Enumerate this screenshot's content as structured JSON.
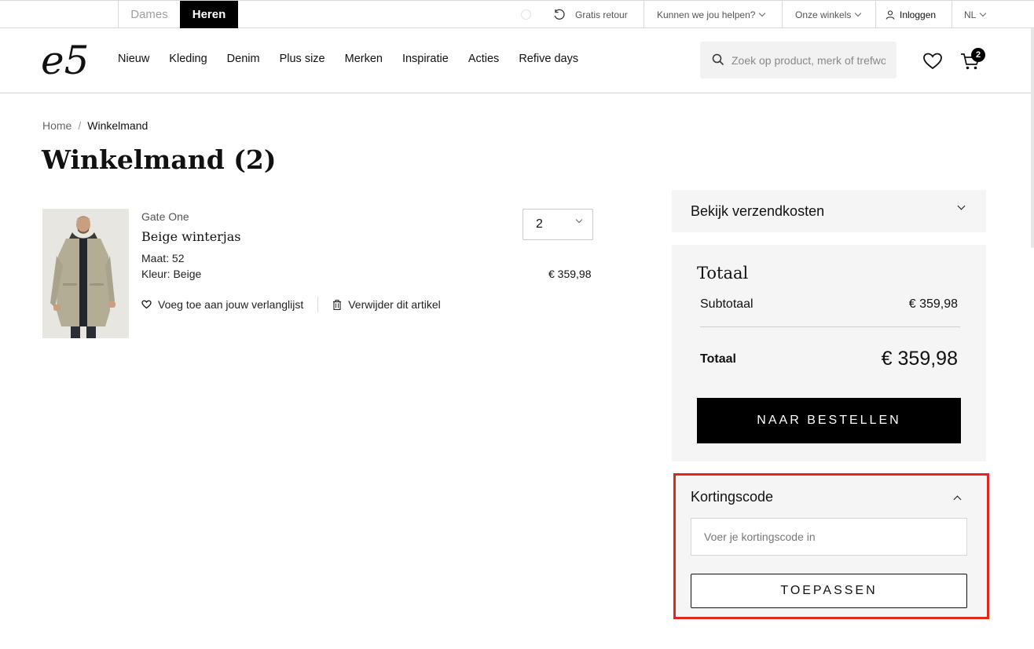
{
  "topbar": {
    "genders": [
      "Dames",
      "Heren"
    ],
    "active_gender": "Heren",
    "retour_label": "Gratis retour",
    "help_label": "Kunnen we jou helpen?",
    "stores_label": "Onze winkels",
    "login_label": "Inloggen",
    "language": "NL"
  },
  "header": {
    "logo_text": "e5",
    "nav": [
      "Nieuw",
      "Kleding",
      "Denim",
      "Plus size",
      "Merken",
      "Inspiratie",
      "Acties",
      "Refive days"
    ],
    "search_placeholder": "Zoek op product, merk of trefwoord",
    "cart_count": "2"
  },
  "breadcrumb": {
    "home": "Home",
    "separator": "/",
    "current": "Winkelmand"
  },
  "page_title": "Winkelmand (2)",
  "cart_item": {
    "brand": "Gate One",
    "name": "Beige winterjas",
    "size_label": "Maat:",
    "size": "52",
    "color_label": "Kleur:",
    "color": "Beige",
    "quantity": "2",
    "price": "€ 359,98",
    "wishlist_label": "Voeg toe aan jouw verlanglijst",
    "remove_label": "Verwijder dit artikel"
  },
  "summary": {
    "shipping_label": "Bekijk verzendkosten",
    "totals_title": "Totaal",
    "subtotal_label": "Subtotaal",
    "subtotal_value": "€ 359,98",
    "total_label": "Totaal",
    "total_value": "€ 359,98",
    "order_button": "NAAR BESTELLEN"
  },
  "discount": {
    "title": "Kortingscode",
    "placeholder": "Voer je kortingscode in",
    "apply_button": "TOEPASSEN",
    "highlight_color": "#e0261f"
  },
  "icons": [
    "retour-icon",
    "user-icon",
    "search-icon",
    "heart-icon",
    "cart-icon",
    "chevron-down-icon",
    "chevron-up-icon",
    "trash-icon"
  ]
}
